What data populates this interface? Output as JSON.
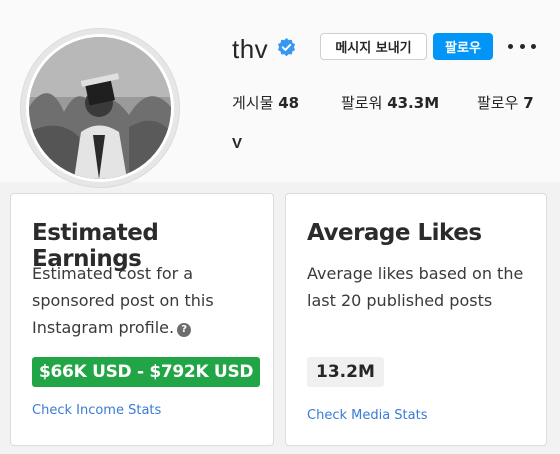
{
  "profile": {
    "username": "thv",
    "message_button": "메시지 보내기",
    "follow_button": "팔로우",
    "stats": {
      "posts_label": "게시물",
      "posts_value": "48",
      "followers_label": "팔로워",
      "followers_value": "43.3M",
      "following_label": "팔로우",
      "following_value": "7"
    },
    "full_name": "V",
    "verified_icon": "verified-badge-icon",
    "more_icon": "more-horizontal-icon"
  },
  "cards": {
    "earnings": {
      "title": "Estimated Earnings",
      "description": "Estimated cost for a sponsored post on this Instagram profile.",
      "help_icon": "question-circle-icon",
      "value": "$66K USD - $792K USD",
      "link": "Check Income Stats"
    },
    "likes": {
      "title": "Average Likes",
      "description": "Average likes based on the last 20 published posts",
      "value": "13.2M",
      "link": "Check Media Stats"
    }
  },
  "colors": {
    "follow_blue": "#0095f6",
    "verified_blue": "#3897f0",
    "earnings_green": "#22a546",
    "link_blue": "#3a7bd5"
  }
}
